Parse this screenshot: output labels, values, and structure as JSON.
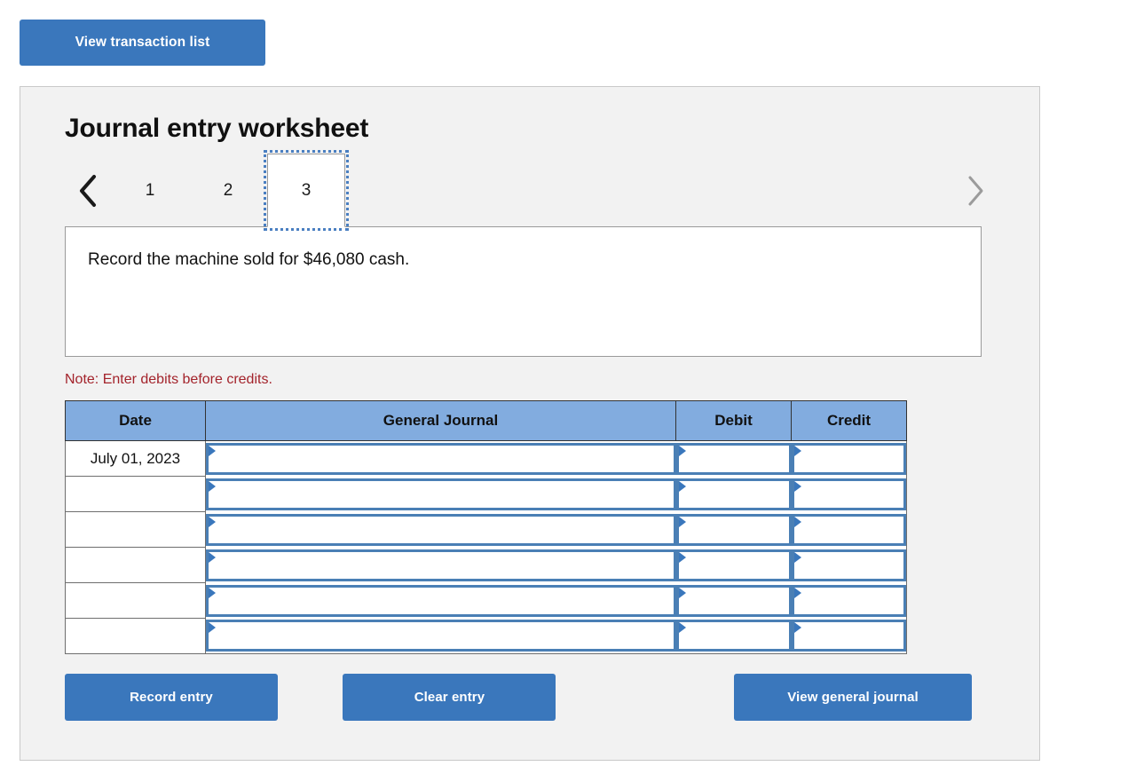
{
  "toolbar": {
    "view_transaction_list_label": "View transaction list"
  },
  "panel": {
    "title": "Journal entry worksheet",
    "tabs": {
      "prev_icon": "chevron-left-icon",
      "next_icon": "chevron-right-icon",
      "items": [
        {
          "label": "1",
          "active": false
        },
        {
          "label": "2",
          "active": false
        },
        {
          "label": "3",
          "active": true
        }
      ]
    },
    "prompt": "Record the machine sold for $46,080 cash.",
    "note": "Note: Enter debits before credits.",
    "table": {
      "headers": [
        "Date",
        "General Journal",
        "Debit",
        "Credit"
      ],
      "rows": [
        {
          "date": "July 01, 2023",
          "general_journal": "",
          "debit": "",
          "credit": ""
        },
        {
          "date": "",
          "general_journal": "",
          "debit": "",
          "credit": ""
        },
        {
          "date": "",
          "general_journal": "",
          "debit": "",
          "credit": ""
        },
        {
          "date": "",
          "general_journal": "",
          "debit": "",
          "credit": ""
        },
        {
          "date": "",
          "general_journal": "",
          "debit": "",
          "credit": ""
        },
        {
          "date": "",
          "general_journal": "",
          "debit": "",
          "credit": ""
        }
      ]
    },
    "actions": {
      "record_entry_label": "Record entry",
      "clear_entry_label": "Clear entry",
      "view_general_journal_label": "View general journal"
    }
  },
  "colors": {
    "button_blue": "#3a77bc",
    "header_blue": "#82acdf",
    "field_border_blue": "#4a7fb5",
    "note_red": "#a3232b",
    "panel_bg": "#f2f2f2",
    "panel_border": "#c9c9c9"
  }
}
